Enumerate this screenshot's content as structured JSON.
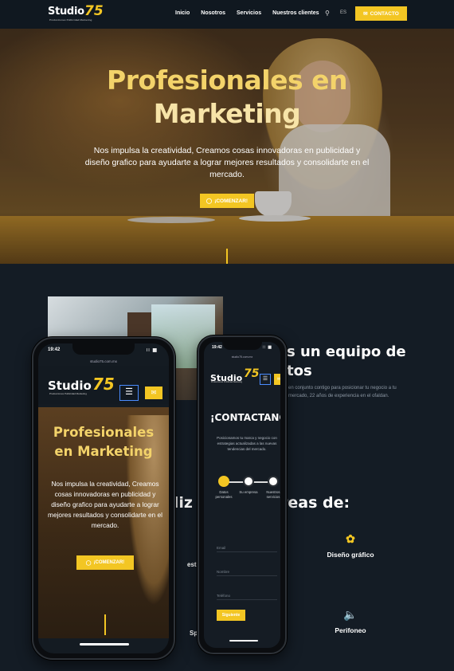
{
  "nav": {
    "logo_word": "Studio",
    "logo_number": "75",
    "logo_tagline": "Producciones Publicidad Marketing",
    "links": [
      "Inicio",
      "Nosotros",
      "Servicios",
      "Nuestros clientes"
    ],
    "lang": "ES",
    "cta_label": "CONTACTO"
  },
  "hero": {
    "title_line1": "Profesionales en",
    "title_line2": "Marketing",
    "text": "Nos impulsa la creatividad, Creamos cosas innovadoras en publicidad y diseño grafico para ayudarte a lograr mejores resultados y consolidarte en el mercado.",
    "button_label": "¡COMENZAR!"
  },
  "about": {
    "heading_line1": "s un equipo de",
    "heading_line2": "tos",
    "description": "en conjunto contigo para posicionar tu negocio a tu mercado, 22 años de experiencia en el ofaldan."
  },
  "areas": {
    "heading": "aliz            s áreas de:",
    "items": [
      {
        "icon": "award-icon",
        "label": "Diseño gráfico"
      },
      {
        "icon": "speaker-icon",
        "label": "Perifoneo"
      }
    ],
    "partial_labels": [
      "est",
      "Sp"
    ]
  },
  "phone1": {
    "time": "19:42",
    "url": "studio75.com.mx",
    "title_line1": "Profesionales",
    "title_line2": "en Marketing",
    "text": "Nos impulsa la creatividad, Creamos cosas innovadoras en publicidad y diseño grafico para ayudarte a lograr mejores resultados y consolidarte en el mercado.",
    "button_label": "¡COMENZAR!"
  },
  "phone2": {
    "time": "19:42",
    "url": "studio75.com.mx",
    "heading": "¡CONTACTANOS!",
    "text": "Posicionamos tu marca y negocio con estrategias actualizadas a las nuevas tendencias del mercado.",
    "steps": [
      "Datos personales",
      "Su empresa",
      "Nuestros servicios"
    ],
    "fields": [
      "Email",
      "Nombre",
      "Teléfono"
    ],
    "submit_label": "Siguiente"
  },
  "colors": {
    "accent": "#f3c623",
    "background": "#141c25"
  }
}
